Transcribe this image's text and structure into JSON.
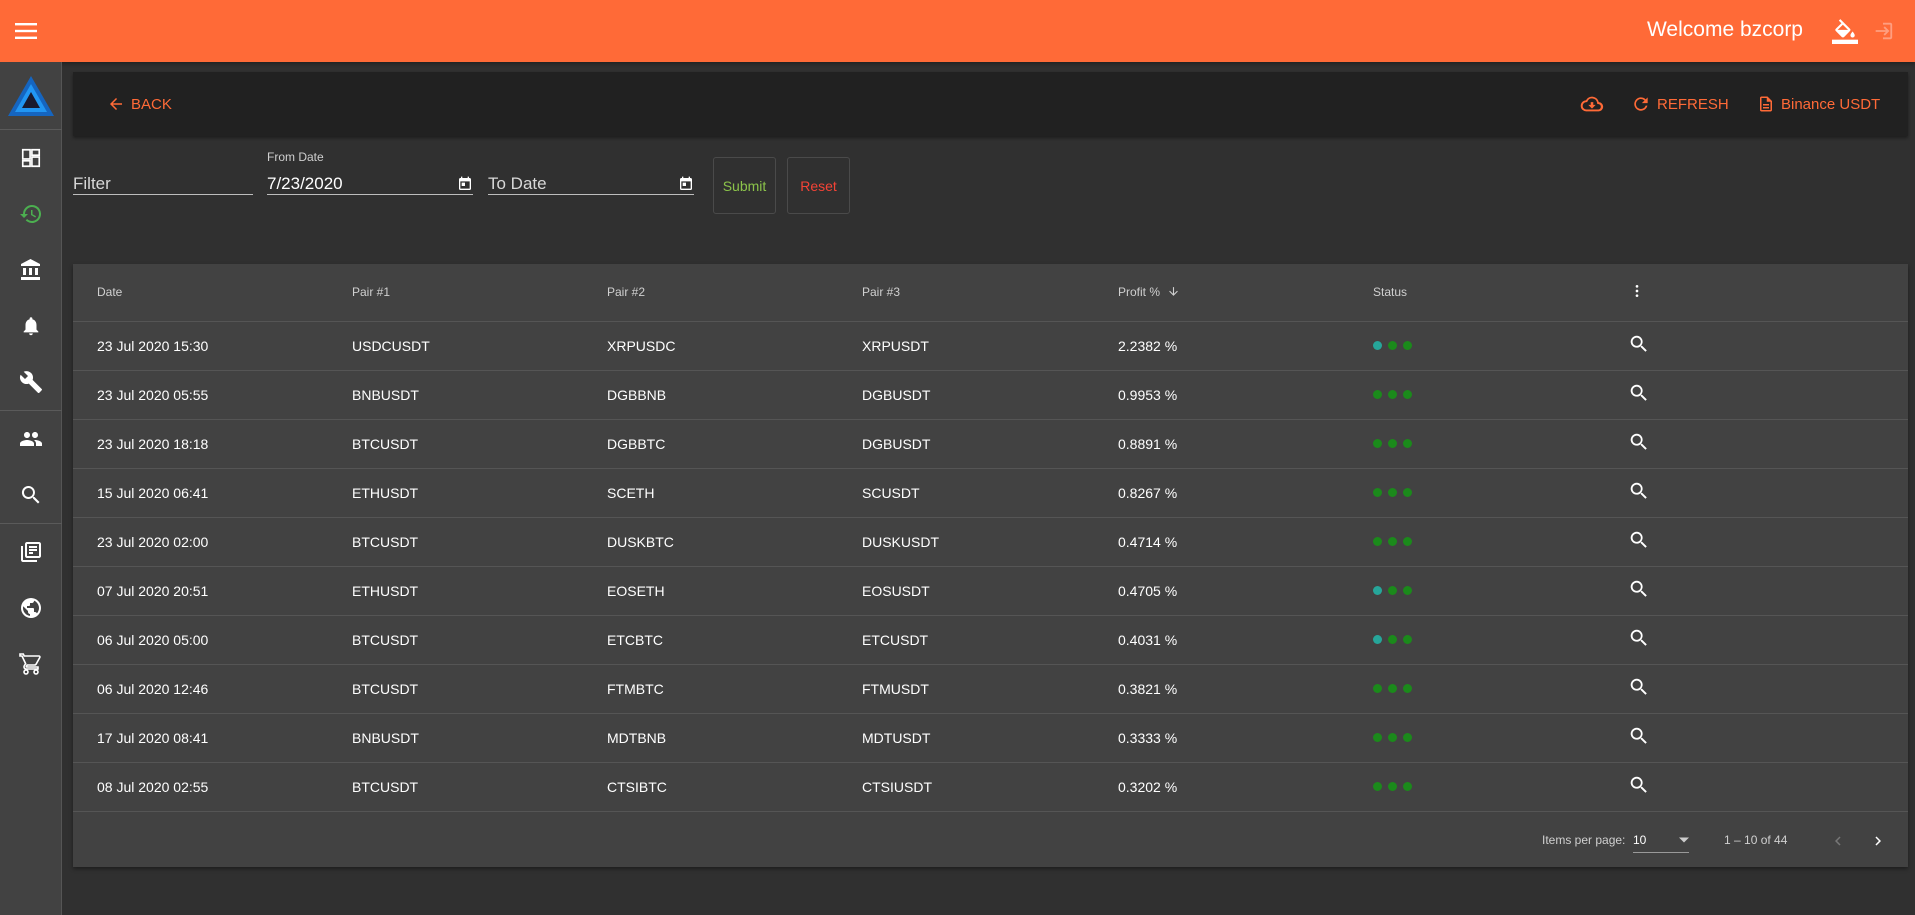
{
  "header": {
    "welcome_text": "Welcome bzcorp",
    "colors": {
      "bar": "#ff6a37",
      "logout_icon": "#ff9e80"
    }
  },
  "sidebar": {
    "items": [
      {
        "icon": "dashboard-icon",
        "active": false
      },
      {
        "icon": "history-icon",
        "active": true
      },
      {
        "icon": "bank-icon",
        "active": false
      },
      {
        "icon": "bell-icon",
        "active": false
      },
      {
        "icon": "wrench-icon",
        "active": false
      },
      {
        "icon": "people-icon",
        "active": false
      },
      {
        "icon": "search-icon",
        "active": false
      },
      {
        "icon": "library-icon",
        "active": false
      },
      {
        "icon": "globe-icon",
        "active": false
      },
      {
        "icon": "cart-icon",
        "active": false
      }
    ],
    "active_color": "#4caf50"
  },
  "toolbar": {
    "back_label": "BACK",
    "refresh_label": "REFRESH",
    "exchange_label": "Binance USDT"
  },
  "filters": {
    "filter_placeholder": "Filter",
    "from_date_label": "From Date",
    "from_date_value": "7/23/2020",
    "to_date_placeholder": "To Date",
    "submit_label": "Submit",
    "reset_label": "Reset",
    "submit_color": "#8bc34a",
    "reset_color": "#f44336"
  },
  "table": {
    "columns": [
      "Date",
      "Pair #1",
      "Pair #2",
      "Pair #3",
      "Profit %",
      "Status"
    ],
    "sort_column": "Profit %",
    "sort_direction": "desc",
    "rows": [
      {
        "date": "23 Jul 2020 15:30",
        "pair1": "USDCUSDT",
        "pair2": "XRPUSDC",
        "pair3": "XRPUSDT",
        "profit": "2.2382 %",
        "status": [
          "teal",
          "green",
          "green"
        ]
      },
      {
        "date": "23 Jul 2020 05:55",
        "pair1": "BNBUSDT",
        "pair2": "DGBBNB",
        "pair3": "DGBUSDT",
        "profit": "0.9953 %",
        "status": [
          "green",
          "green",
          "green"
        ]
      },
      {
        "date": "23 Jul 2020 18:18",
        "pair1": "BTCUSDT",
        "pair2": "DGBBTC",
        "pair3": "DGBUSDT",
        "profit": "0.8891 %",
        "status": [
          "green",
          "green",
          "green"
        ]
      },
      {
        "date": "15 Jul 2020 06:41",
        "pair1": "ETHUSDT",
        "pair2": "SCETH",
        "pair3": "SCUSDT",
        "profit": "0.8267 %",
        "status": [
          "green",
          "green",
          "green"
        ]
      },
      {
        "date": "23 Jul 2020 02:00",
        "pair1": "BTCUSDT",
        "pair2": "DUSKBTC",
        "pair3": "DUSKUSDT",
        "profit": "0.4714 %",
        "status": [
          "green",
          "green",
          "green"
        ]
      },
      {
        "date": "07 Jul 2020 20:51",
        "pair1": "ETHUSDT",
        "pair2": "EOSETH",
        "pair3": "EOSUSDT",
        "profit": "0.4705 %",
        "status": [
          "teal",
          "green",
          "green"
        ]
      },
      {
        "date": "06 Jul 2020 05:00",
        "pair1": "BTCUSDT",
        "pair2": "ETCBTC",
        "pair3": "ETCUSDT",
        "profit": "0.4031 %",
        "status": [
          "teal",
          "green",
          "green"
        ]
      },
      {
        "date": "06 Jul 2020 12:46",
        "pair1": "BTCUSDT",
        "pair2": "FTMBTC",
        "pair3": "FTMUSDT",
        "profit": "0.3821 %",
        "status": [
          "green",
          "green",
          "green"
        ]
      },
      {
        "date": "17 Jul 2020 08:41",
        "pair1": "BNBUSDT",
        "pair2": "MDTBNB",
        "pair3": "MDTUSDT",
        "profit": "0.3333 %",
        "status": [
          "green",
          "green",
          "green"
        ]
      },
      {
        "date": "08 Jul 2020 02:55",
        "pair1": "BTCUSDT",
        "pair2": "CTSIBTC",
        "pair3": "CTSIUSDT",
        "profit": "0.3202 %",
        "status": [
          "green",
          "green",
          "green"
        ]
      }
    ],
    "status_colors": {
      "teal": "#26a69a",
      "green": "#1b8a1b"
    }
  },
  "paginator": {
    "items_per_page_label": "Items per page:",
    "page_size": "10",
    "range_label": "1 – 10 of 44"
  }
}
